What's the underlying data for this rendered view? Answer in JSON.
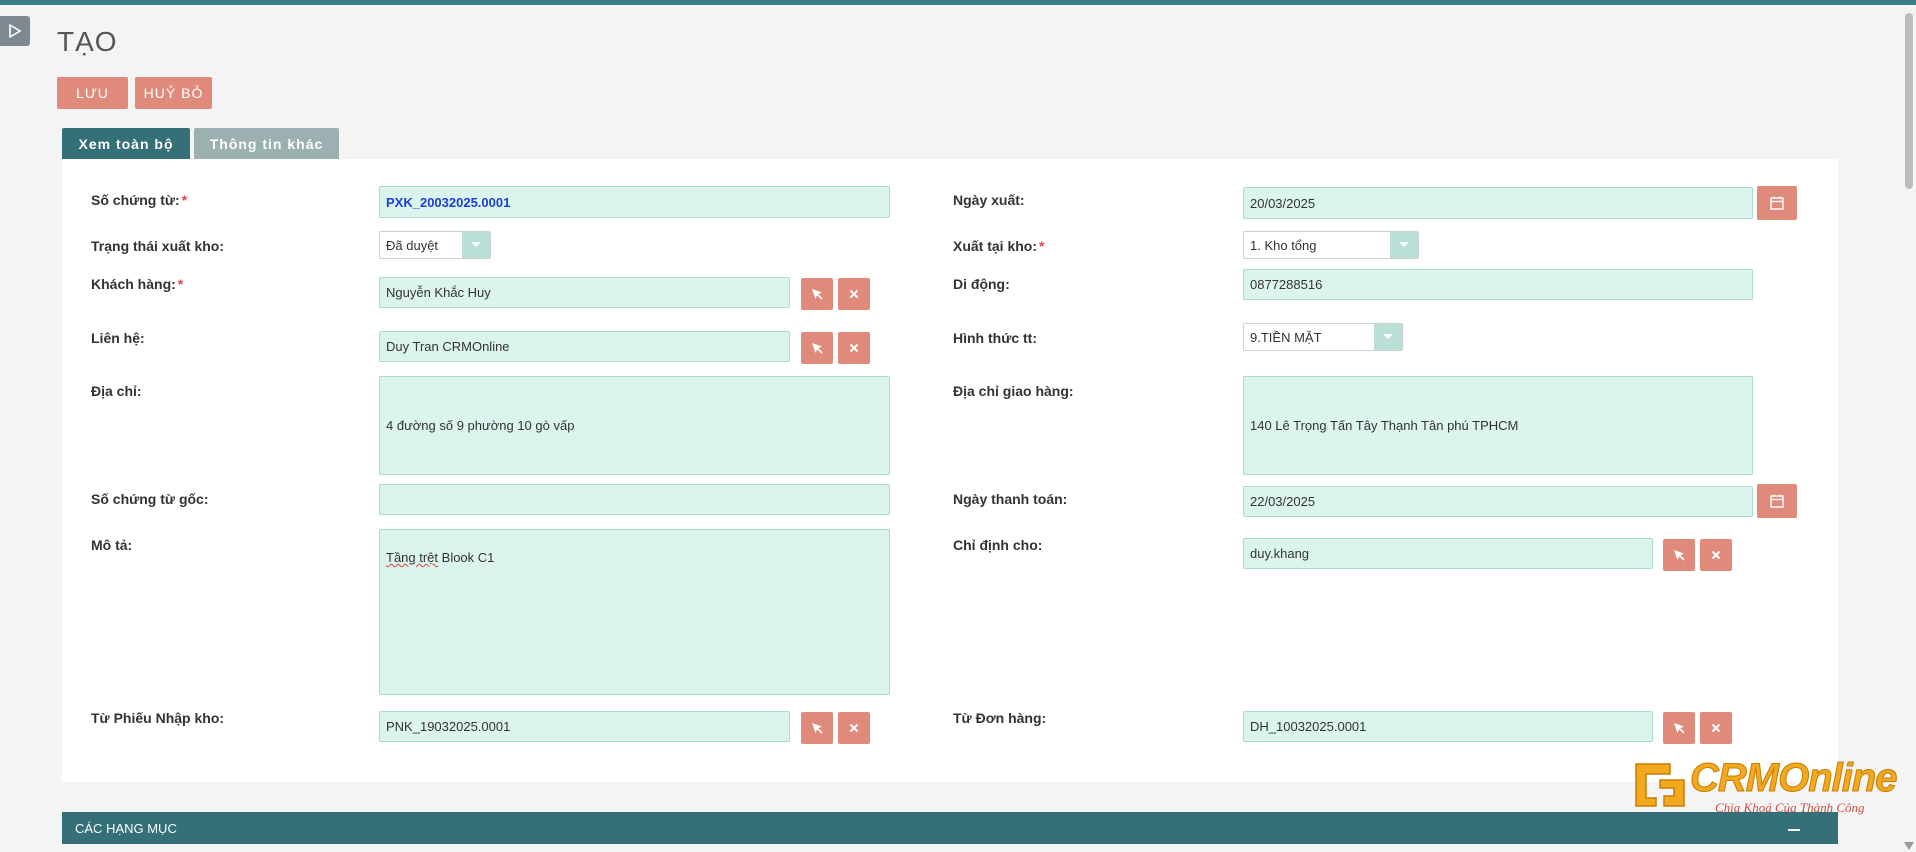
{
  "page": {
    "title": "TẠO"
  },
  "toolbar": {
    "save_label": "LƯU",
    "cancel_label": "HUỶ BỎ"
  },
  "tabs": [
    {
      "label": "Xem toàn bộ",
      "active": true
    },
    {
      "label": "Thông tin khác",
      "active": false
    }
  ],
  "form": {
    "doc_number": {
      "label": "Số chứng từ:",
      "required_mark": "*",
      "value": "PXK_20032025.0001"
    },
    "export_date": {
      "label": "Ngày xuất:",
      "value": "20/03/2025"
    },
    "export_status": {
      "label": "Trạng thái xuất kho:",
      "value": "Đã duyệt"
    },
    "export_warehouse": {
      "label": "Xuất tại kho:",
      "required_mark": "*",
      "value": "1. Kho tổng"
    },
    "customer": {
      "label": "Khách hàng:",
      "required_mark": "*",
      "value": "Nguyễn Khắc Huy"
    },
    "mobile": {
      "label": "Di động:",
      "value": "0877288516"
    },
    "contact": {
      "label": "Liên hệ:",
      "value": "Duy Tran CRMOnline"
    },
    "payment_method": {
      "label": "Hình thức tt:",
      "value": "9.TIỀN MẶT"
    },
    "address": {
      "label": "Địa chỉ:",
      "value": "4 đường số 9 phường 10 gò vấp"
    },
    "delivery_address": {
      "label": "Địa chỉ giao hàng:",
      "value": "140 Lê Trọng Tấn Tây Thạnh Tân phú TPHCM"
    },
    "original_doc": {
      "label": "Số chứng từ gốc:",
      "value": ""
    },
    "payment_date": {
      "label": "Ngày thanh toán:",
      "value": "22/03/2025"
    },
    "description": {
      "label": "Mô tả:",
      "value_underlined": "Tầng trệt",
      "value_rest": " Blook C1"
    },
    "assigned_to": {
      "label": "Chỉ định cho:",
      "value": "duy.khang"
    },
    "from_receipt": {
      "label": "Từ Phiếu Nhập kho:",
      "value": "PNK_19032025.0001"
    },
    "from_order": {
      "label": "Từ Đơn hàng:",
      "value": "DH_10032025.0001"
    }
  },
  "section": {
    "title": "CÁC HẠNG MỤC"
  },
  "logo": {
    "brand": "CRMOnline",
    "slogan": "Chìa Khoá Của Thành Công"
  },
  "colors": {
    "accent": "#356f78",
    "button": "#e08a7c",
    "field_bg": "#dcf4ee",
    "logo": "#f2a91d"
  },
  "icons": {
    "select": "cursor-arrow-icon",
    "clear": "close-icon",
    "calendar": "calendar-icon",
    "sidebar": "play-icon"
  }
}
